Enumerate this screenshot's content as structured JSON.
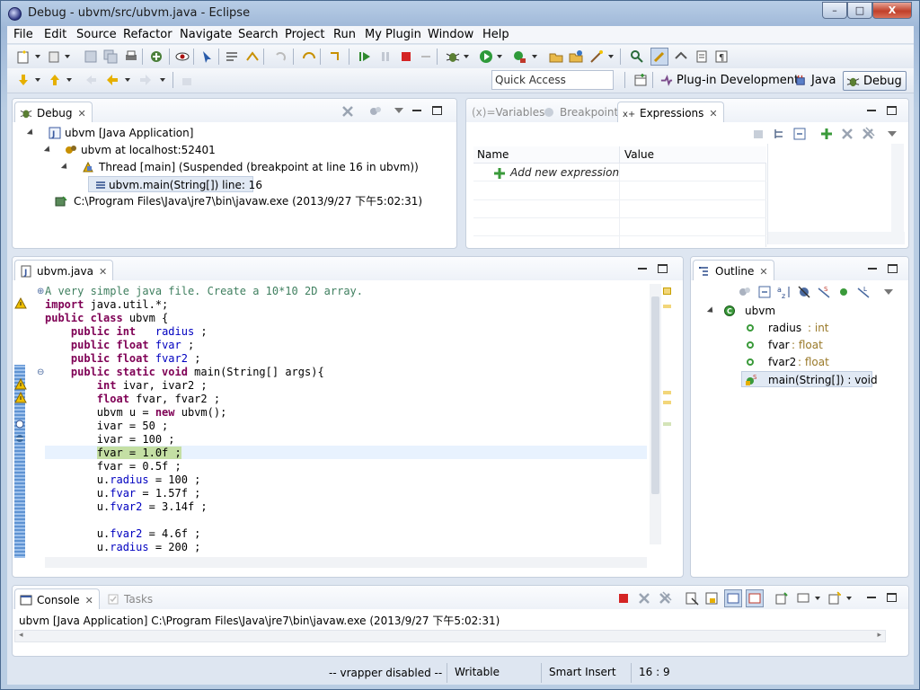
{
  "window": {
    "title": "Debug - ubvm/src/ubvm.java - Eclipse",
    "controls": {
      "minimize": "–",
      "maximize": "□",
      "close": "X"
    }
  },
  "menu": [
    "File",
    "Edit",
    "Source",
    "Refactor",
    "Navigate",
    "Search",
    "Project",
    "Run",
    "My Plugin",
    "Window",
    "Help"
  ],
  "quick_access": {
    "placeholder": "Quick Access"
  },
  "perspectives": [
    {
      "label": "Plug-in Development",
      "icon": "plugin-perspective-icon"
    },
    {
      "label": "Java",
      "icon": "java-perspective-icon"
    },
    {
      "label": "Debug",
      "icon": "debug-perspective-icon",
      "active": true
    }
  ],
  "debug_view": {
    "tab": "Debug",
    "tree": [
      {
        "label": "ubvm [Java Application]",
        "icon": "java-app-icon",
        "level": 1,
        "expanded": true
      },
      {
        "label": "ubvm at localhost:52401",
        "icon": "vm-icon",
        "level": 2,
        "expanded": true
      },
      {
        "label": "Thread [main] (Suspended (breakpoint at line 16 in ubvm))",
        "icon": "thread-icon",
        "level": 3,
        "expanded": true
      },
      {
        "label": "ubvm.main(String[]) line: 16",
        "icon": "stack-frame-icon",
        "level": 4,
        "selected": true
      },
      {
        "label": "C:\\Program Files\\Java\\jre7\\bin\\javaw.exe (2013/9/27 下午5:02:31)",
        "icon": "process-icon",
        "level": 2
      }
    ]
  },
  "expressions_view": {
    "tabs": [
      {
        "label": "Variables",
        "icon": "variables-icon",
        "prefix": "(x)="
      },
      {
        "label": "Breakpoints",
        "icon": "breakpoints-icon"
      },
      {
        "label": "Expressions",
        "icon": "expressions-icon",
        "active": true
      }
    ],
    "columns": [
      "Name",
      "Value"
    ],
    "add_row": "Add new expression"
  },
  "editor": {
    "tab": "ubvm.java",
    "lines": [
      {
        "segments": [
          [
            "cm",
            "A very simple java file. Create a 10*10 2D array."
          ]
        ],
        "fold": "plus"
      },
      {
        "segments": [
          [
            "kw",
            "import"
          ],
          [
            "",
            " java.util.*;"
          ]
        ]
      },
      {
        "segments": [
          [
            "kw",
            "public class"
          ],
          [
            "",
            " ubvm {"
          ]
        ]
      },
      {
        "segments": [
          [
            "",
            "    "
          ],
          [
            "kw",
            "public int"
          ],
          [
            "",
            "   "
          ],
          [
            "fd",
            "radius"
          ],
          [
            "",
            " ;"
          ]
        ]
      },
      {
        "segments": [
          [
            "",
            "    "
          ],
          [
            "kw",
            "public float"
          ],
          [
            "",
            " "
          ],
          [
            "fd",
            "fvar"
          ],
          [
            "",
            " ;"
          ]
        ]
      },
      {
        "segments": [
          [
            "",
            "    "
          ],
          [
            "kw",
            "public float"
          ],
          [
            "",
            " "
          ],
          [
            "fd",
            "fvar2"
          ],
          [
            "",
            " ;"
          ]
        ]
      },
      {
        "segments": [
          [
            "",
            "    "
          ],
          [
            "kw",
            "public static void"
          ],
          [
            "",
            " main(String[] args){"
          ]
        ],
        "fold": "minus"
      },
      {
        "segments": [
          [
            "",
            "        "
          ],
          [
            "kw",
            "int"
          ],
          [
            "",
            " ivar, ivar2 ;"
          ]
        ]
      },
      {
        "segments": [
          [
            "",
            "        "
          ],
          [
            "kw",
            "float"
          ],
          [
            "",
            " fvar, fvar2 ;"
          ]
        ]
      },
      {
        "segments": [
          [
            "",
            "        ubvm u = "
          ],
          [
            "kw",
            "new"
          ],
          [
            "",
            " ubvm();"
          ]
        ]
      },
      {
        "segments": [
          [
            "",
            "        ivar = 50 ;"
          ]
        ]
      },
      {
        "segments": [
          [
            "",
            "        ivar = 100 ;"
          ]
        ]
      },
      {
        "segments": [
          [
            "",
            "        "
          ],
          [
            "hl",
            "fvar = 1.0f ;"
          ]
        ],
        "current": true
      },
      {
        "segments": [
          [
            "",
            "        fvar = 0.5f ;"
          ]
        ]
      },
      {
        "segments": [
          [
            "",
            "        u."
          ],
          [
            "fd",
            "radius"
          ],
          [
            "",
            " = 100 ;"
          ]
        ]
      },
      {
        "segments": [
          [
            "",
            "        u."
          ],
          [
            "fd",
            "fvar"
          ],
          [
            "",
            " = 1.57f ;"
          ]
        ]
      },
      {
        "segments": [
          [
            "",
            "        u."
          ],
          [
            "fd",
            "fvar2"
          ],
          [
            "",
            " = 3.14f ;"
          ]
        ]
      },
      {
        "segments": [
          [
            "",
            ""
          ]
        ]
      },
      {
        "segments": [
          [
            "",
            "        u."
          ],
          [
            "fd",
            "fvar2"
          ],
          [
            "",
            " = 4.6f ;"
          ]
        ]
      },
      {
        "segments": [
          [
            "",
            "        u."
          ],
          [
            "fd",
            "radius"
          ],
          [
            "",
            " = 200 ;"
          ]
        ]
      }
    ]
  },
  "outline": {
    "tab": "Outline",
    "tree": [
      {
        "label": "ubvm",
        "icon": "class-icon"
      },
      {
        "label": "radius",
        "type": " : int",
        "icon": "field-icon"
      },
      {
        "label": "fvar",
        "type": " : float",
        "icon": "field-icon"
      },
      {
        "label": "fvar2",
        "type": " : float",
        "icon": "field-icon"
      },
      {
        "label": "main(String[]) : void",
        "icon": "static-method-icon",
        "selected": true
      }
    ]
  },
  "console": {
    "tabs": [
      {
        "label": "Console",
        "icon": "console-icon",
        "active": true
      },
      {
        "label": "Tasks",
        "icon": "tasks-icon"
      }
    ],
    "text": "ubvm [Java Application] C:\\Program Files\\Java\\jre7\\bin\\javaw.exe (2013/9/27 下午5:02:31)"
  },
  "status": {
    "message": "-- vrapper disabled --",
    "mode": "Writable",
    "insert": "Smart Insert",
    "position": "16 : 9"
  },
  "colors": {
    "keyword": "#7f0055",
    "field": "#0000c0",
    "comment": "#3f7f5f",
    "current_line_highlight": "#c4dfa4",
    "window_frame": "#6d8fb6"
  }
}
